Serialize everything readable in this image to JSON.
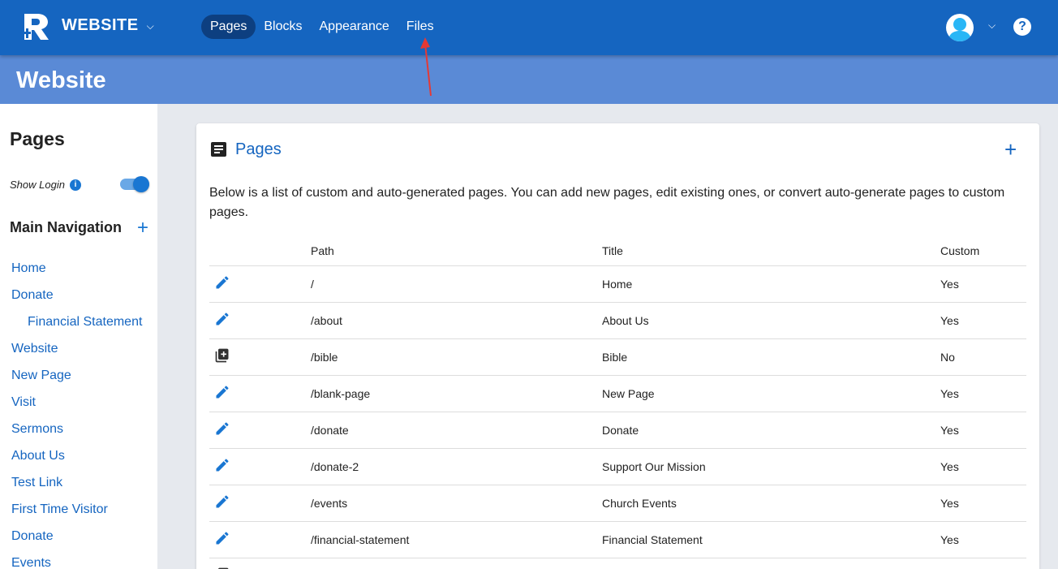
{
  "topbar": {
    "brand": "WEBSITE",
    "nav": [
      {
        "label": "Pages",
        "active": true
      },
      {
        "label": "Blocks",
        "active": false
      },
      {
        "label": "Appearance",
        "active": false
      },
      {
        "label": "Files",
        "active": false
      }
    ],
    "help_label": "?"
  },
  "header": {
    "title": "Website"
  },
  "sidebar": {
    "title": "Pages",
    "show_login_label": "Show Login",
    "show_login_enabled": true,
    "main_navigation_title": "Main Navigation",
    "items": [
      {
        "label": "Home",
        "sub": false
      },
      {
        "label": "Donate",
        "sub": false
      },
      {
        "label": "Financial Statement",
        "sub": true
      },
      {
        "label": "Website",
        "sub": false
      },
      {
        "label": "New Page",
        "sub": false
      },
      {
        "label": "Visit",
        "sub": false
      },
      {
        "label": "Sermons",
        "sub": false
      },
      {
        "label": "About Us",
        "sub": false
      },
      {
        "label": "Test Link",
        "sub": false
      },
      {
        "label": "First Time Visitor",
        "sub": false
      },
      {
        "label": "Donate",
        "sub": false
      },
      {
        "label": "Events",
        "sub": false
      }
    ]
  },
  "card": {
    "title": "Pages",
    "description": "Below is a list of custom and auto-generated pages. You can add new pages, edit existing ones, or convert auto-generate pages to custom pages.",
    "columns": [
      "",
      "Path",
      "Title",
      "Custom"
    ],
    "rows": [
      {
        "icon": "edit-icon",
        "path": "/",
        "title": "Home",
        "custom": "Yes"
      },
      {
        "icon": "edit-icon",
        "path": "/about",
        "title": "About Us",
        "custom": "Yes"
      },
      {
        "icon": "convert-page-icon",
        "path": "/bible",
        "title": "Bible",
        "custom": "No"
      },
      {
        "icon": "edit-icon",
        "path": "/blank-page",
        "title": "New Page",
        "custom": "Yes"
      },
      {
        "icon": "edit-icon",
        "path": "/donate",
        "title": "Donate",
        "custom": "Yes"
      },
      {
        "icon": "edit-icon",
        "path": "/donate-2",
        "title": "Support Our Mission",
        "custom": "Yes"
      },
      {
        "icon": "edit-icon",
        "path": "/events",
        "title": "Church Events",
        "custom": "Yes"
      },
      {
        "icon": "edit-icon",
        "path": "/financial-statement",
        "title": "Financial Statement",
        "custom": "Yes"
      },
      {
        "icon": "convert-page-icon",
        "path": "",
        "title": "",
        "custom": ""
      }
    ]
  },
  "colors": {
    "topbar": "#1565c0",
    "header_band": "#5a8ad6",
    "accent": "#1976d2",
    "annotation_arrow": "#e53935"
  }
}
